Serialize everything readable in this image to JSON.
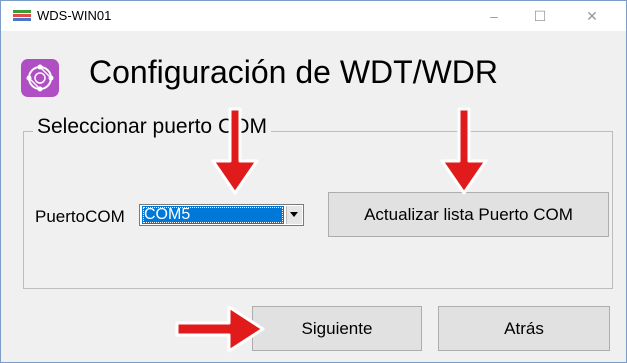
{
  "window": {
    "title": "WDS-WIN01",
    "controls": {
      "minimize": "–",
      "maximize": "☐",
      "close": "✕"
    }
  },
  "header": {
    "title": "Configuración de WDT/WDR",
    "icon": "network-globe-icon",
    "icon_color": "#b04fc4"
  },
  "group": {
    "legend": "Seleccionar puerto COM"
  },
  "port": {
    "label": "PuertoCOM",
    "selected": "COM5"
  },
  "buttons": {
    "refresh": "Actualizar lista Puerto COM",
    "next": "Siguiente",
    "back": "Atrás"
  },
  "annotations": {
    "arrow_color": "#e11b1b"
  }
}
